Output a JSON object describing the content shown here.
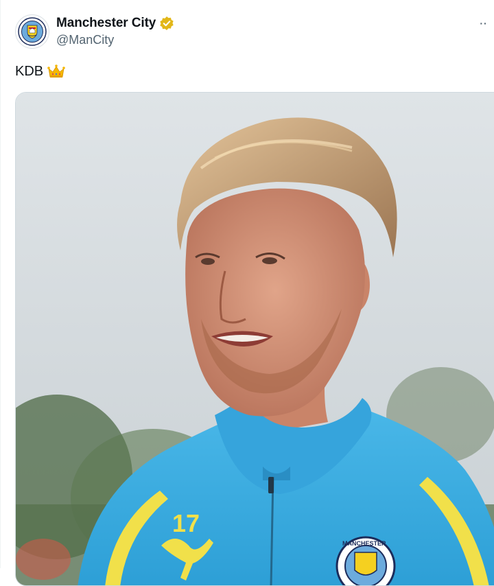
{
  "account": {
    "display_name": "Manchester City",
    "handle": "@ManCity",
    "avatar_icon": "man-city-crest-icon",
    "verified_icon": "verified-gold-badge-icon",
    "verified_color": "#e2b719"
  },
  "menu": {
    "more_label": "··",
    "more_icon": "more-options-icon"
  },
  "tweet": {
    "text": "KDB",
    "emoji_icon": "crown-emoji-icon"
  },
  "media": {
    "icon": "photo-player-portrait",
    "shirt_number": "17",
    "badge_text": "MANCHESTER"
  },
  "colors": {
    "sky_blue": "#3fb0e4",
    "kit_yellow": "#f1e04a",
    "text_secondary": "#536471"
  }
}
